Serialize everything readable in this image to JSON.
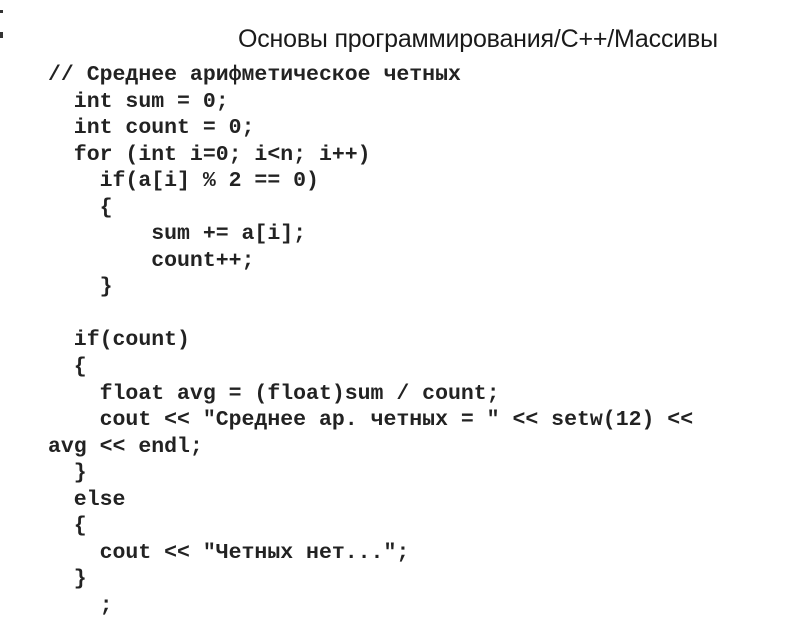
{
  "slide": {
    "title": "Основы программирования/C++/Массивы",
    "code_lines": [
      "// Среднее арифметическое четных",
      "  int sum = 0;",
      "  int count = 0;",
      "  for (int i=0; i<n; i++)",
      "    if(a[i] % 2 == 0)",
      "    {",
      "        sum += a[i];",
      "        count++;",
      "    }",
      "",
      "  if(count)",
      "  {",
      "    float avg = (float)sum / count;",
      "    cout << \"Среднее ар. четных = \" << setw(12) <<",
      "avg << endl;",
      "  }",
      "  else",
      "  {",
      "    cout << \"Четных нет...\";",
      "  }",
      "    ;"
    ]
  }
}
